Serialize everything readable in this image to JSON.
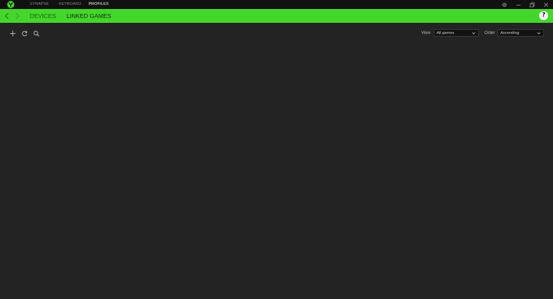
{
  "window": {
    "top_nav": [
      {
        "label": "SYNAPSE",
        "active": false
      },
      {
        "label": "KEYBOARD",
        "active": false
      },
      {
        "label": "PROFILES",
        "active": true
      }
    ],
    "controls": [
      "settings-icon",
      "minimize-icon",
      "restore-icon",
      "close-icon"
    ]
  },
  "subheader": {
    "tabs": [
      {
        "label": "DEVICES",
        "active": false
      },
      {
        "label": "LINKED GAMES",
        "active": true
      }
    ],
    "help_label": "?"
  },
  "toolbar": {
    "icons": [
      "add-icon",
      "refresh-icon",
      "search-icon"
    ],
    "view_label": "View",
    "view_value": "All games",
    "order_label": "Order",
    "order_value": "Ascending"
  },
  "colors": {
    "accent": "#44d62c",
    "titlebar": "#111111",
    "background": "#232323"
  }
}
